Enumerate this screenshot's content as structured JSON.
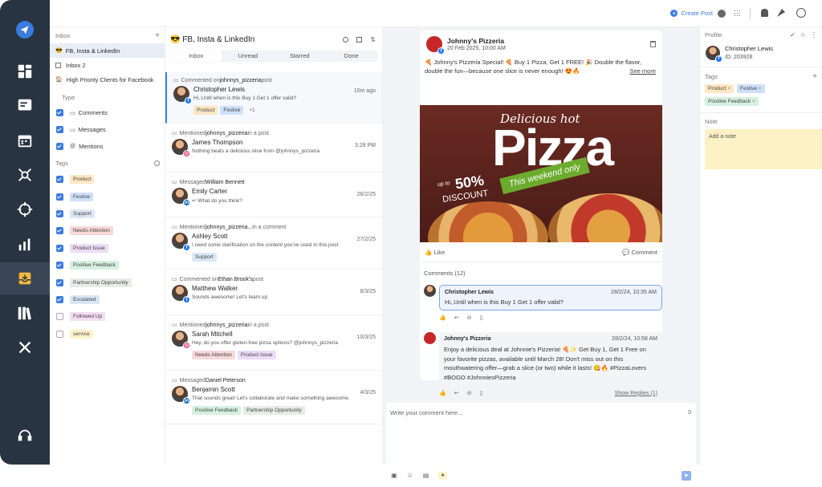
{
  "topbar": {
    "create_post": "Create Post"
  },
  "inbox_nav": {
    "title": "Inbox",
    "inboxes": [
      {
        "label": "FB, Insta & LinkedIn",
        "emoji": "😎"
      },
      {
        "label": "Inbox 2",
        "emoji": ""
      },
      {
        "label": "High Priority Clients for Facebook",
        "emoji": "🏠"
      }
    ],
    "type_title": "Type",
    "types": [
      "Comments",
      "Messages",
      "Mentions"
    ],
    "tags_title": "Tags",
    "tags": [
      {
        "label": "Product",
        "cls": "t-product",
        "checked": true
      },
      {
        "label": "Festive",
        "cls": "t-festive",
        "checked": true
      },
      {
        "label": "Support",
        "cls": "t-support",
        "checked": true
      },
      {
        "label": "Needs Attention",
        "cls": "t-needs",
        "checked": true
      },
      {
        "label": "Product Issue",
        "cls": "t-issue",
        "checked": true
      },
      {
        "label": "Positive Feedback",
        "cls": "t-pos",
        "checked": true
      },
      {
        "label": "Partnership Opportunity",
        "cls": "t-part",
        "checked": true
      },
      {
        "label": "Escalated",
        "cls": "t-esc",
        "checked": true
      },
      {
        "label": "Followed Up",
        "cls": "t-follow",
        "checked": false
      },
      {
        "label": "service",
        "cls": "t-service",
        "checked": false
      }
    ]
  },
  "convs": {
    "title": "😎 FB, Insta & LinkedIn",
    "tabs": [
      "Inbox",
      "Unread",
      "Starred",
      "Done"
    ],
    "items": [
      {
        "ctx_pre": "Commented on ",
        "ctx_link": "johnnys_pizzeria",
        "ctx_post": " post",
        "name": "Christopher Lewis",
        "time": "10m ago",
        "text": "Hi,.Until when is this Buy 1 Get 1 offer valid?",
        "net": "fb",
        "tags": [
          {
            "l": "Product",
            "c": "t-product"
          },
          {
            "l": "Festive",
            "c": "t-festive"
          },
          {
            "l": "+1",
            "c": ""
          }
        ]
      },
      {
        "ctx_pre": "Mentioned ",
        "ctx_link": "johnnys_pizzeria",
        "ctx_post": " in a post",
        "name": "James Thompson",
        "time": "3:28 PM",
        "text": "Nothing beats a delicious slice from @johnnys_pizzeria",
        "net": "ig",
        "tags": []
      },
      {
        "ctx_pre": "Messaged ",
        "ctx_link": "William Bennett",
        "ctx_post": "",
        "name": "Emily Carter",
        "time": "26/2/25",
        "text": "↩ What do you think?",
        "net": "li",
        "tags": []
      },
      {
        "ctx_pre": "Mentioned ",
        "ctx_link": "johnnys_pizzeria...",
        "ctx_post": " in a comment",
        "name": "Ashley Scott",
        "time": "27/2/25",
        "text": "I need some clarification on the content you've used in this post",
        "net": "fb",
        "tags": [
          {
            "l": "Support",
            "c": "t-support"
          }
        ]
      },
      {
        "ctx_pre": "Commented on ",
        "ctx_link": "Ethan Brook's",
        "ctx_post": " post",
        "name": "Matthew Walker",
        "time": "6/3/25",
        "text": "Sounds awesome! Let's team up",
        "net": "fb",
        "tags": []
      },
      {
        "ctx_pre": "Mentioned ",
        "ctx_link": "johnnys_pizzeria",
        "ctx_post": " in a post",
        "name": "Sarah Mitchell",
        "time": "10/3/25",
        "text": "Hey, do you offer gluten-free pizza options? @johnnys_pizzeria",
        "net": "ig",
        "tags": [
          {
            "l": "Needs Attention",
            "c": "t-needs"
          },
          {
            "l": "Product Issue",
            "c": "t-issue"
          }
        ]
      },
      {
        "ctx_pre": "Messaged ",
        "ctx_link": "Daniel Peterson",
        "ctx_post": "",
        "name": "Benjamin Scott",
        "time": "4/3/25",
        "text": "That sounds great! Let's collaborate and make something awesome.",
        "net": "li",
        "tags": [
          {
            "l": "Positive Feedback",
            "c": "t-pos"
          },
          {
            "l": "Partnership Opportunity",
            "c": "t-part"
          }
        ]
      }
    ]
  },
  "post": {
    "page_name": "Johnny's Pizzeria",
    "date": "20 Feb 2025, 10:00 AM",
    "caption": "🍕 Johnny's Pizzeria Special! 🍕 Buy 1 Pizza, Get 1 FREE! 🎉 Double the flavor, double the fun—because one slice is never enough! 😍🔥",
    "see_more": "See more",
    "image": {
      "word1": "Delicious hot",
      "word2": "Pizza",
      "banner": "This weekend only",
      "disc1": "up to",
      "disc2": "50%",
      "disc3": "DISCOUNT"
    },
    "like": "Like",
    "comment": "Comment",
    "comments_title": "Comments (12)",
    "comments": [
      {
        "name": "Christopher Lewis",
        "time": "28/2/24, 10:35 AM",
        "text": "Hi,.Until when is this Buy 1 Get 1 offer valid?"
      },
      {
        "name": "Johnny's Pizzeria",
        "time": "28/2/24, 10:58 AM",
        "text": "Enjoy a delicious deal at Johnnie's Pizzeria! 🍕✨ Get Buy 1, Get 1 Free on your favorite pizzas, available until March 28! Don't miss out on this mouthwatering offer—grab a slice (or two) while it lasts! 😋🔥 #PizzaLovers #BOGO #JohnniesPizzeria",
        "show_replies": "Show Replies (1)"
      }
    ],
    "reply_placeholder": "Write your comment here...",
    "char_count": "0"
  },
  "profile": {
    "title": "Profile",
    "name": "Christopher Lewis",
    "id": "ID: 203928",
    "tags_title": "Tags",
    "tags": [
      {
        "l": "Product",
        "c": "t-product"
      },
      {
        "l": "Festive",
        "c": "t-festive"
      },
      {
        "l": "Positive Feedback",
        "c": "t-pos"
      }
    ],
    "note_title": "Note",
    "note_placeholder": "Add a note"
  },
  "colors": {
    "rail": "#283442",
    "accent": "#3a7be0"
  }
}
